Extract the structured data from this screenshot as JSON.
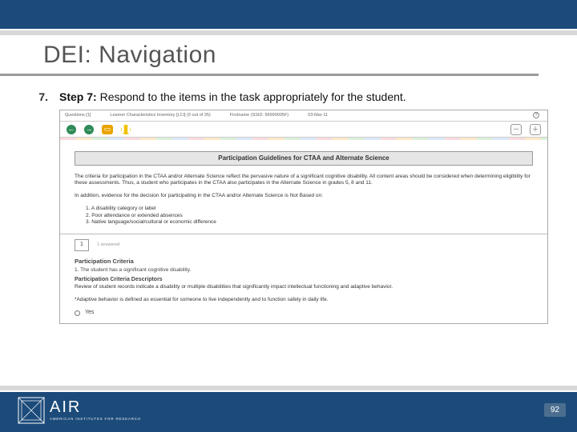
{
  "title": "DEI: Navigation",
  "step": {
    "number": "7.",
    "label": "Step 7:",
    "desc_part1": " Respond to the items in the task appropriately for the student."
  },
  "screenshot": {
    "top": {
      "questions": "Questions [1]",
      "inventory": "Learner Characteristics Inventory [LCI] (0 out of 35)",
      "firstname": "Firstname (SSID: 99999005F)",
      "date": "03-Mar-11"
    },
    "banner": "Participation Guidelines for CTAA and Alternate Science",
    "para1": "The criteria for participation in the CTAA and/or Alternate Science reflect the pervasive nature of a significant cognitive disability. All content areas should be considered when determining eligibility for these assessments. Thus, a student who participates in the CTAA also participates in the Alternate Science in grades 5, 8 and 11.",
    "para2": "In addition, evidence for the decision for participating in the CTAA and/or Alternate Science is Not Based on:",
    "list": {
      "i1": "1.   A disability category or label",
      "i2": "2.   Poor attendance or extended absences",
      "i3": "3.   Native language/social/cultural or economic difference"
    },
    "qnum": "1",
    "dimmed": "1 answered",
    "crit_title": "Participation Criteria",
    "crit_line": "1.   The student has a significant cognitive disability.",
    "crit_desc_title": "Participation Criteria Descriptors",
    "crit_desc1": "Review of student records indicate a disability or multiple disabilities that significantly impact intellectual functioning and adaptive behavior.",
    "crit_desc2": "*Adaptive behavior is defined as essential for someone to live independently and to function safely in daily life.",
    "answer_label": "Yes"
  },
  "footer": {
    "logo_main": "AIR",
    "logo_sub": "AMERICAN INSTITUTES FOR RESEARCH",
    "page": "92"
  }
}
